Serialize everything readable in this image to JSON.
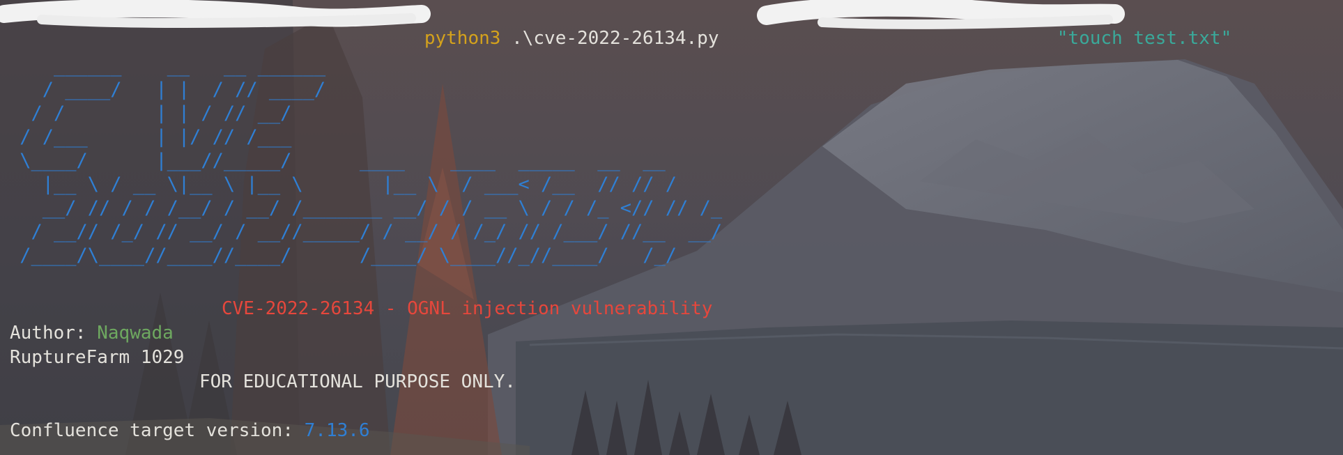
{
  "command": {
    "program": "python3",
    "script": ".\\cve-2022-26134.py",
    "argument": "\"touch test.txt\""
  },
  "banner": {
    "ascii_art": "    ______    __   __ ______\n   / ____/   | |  / // ____/\n  / /        | | / // __/\n / /___      | |/ // /___\n \\____/      |___//_____/      ____    ____  _____  __  __\n   |__ \\ / __ \\|__ \\ |__ \\       |__ \\  / ___< /__  // // /\n   __/ // / / /__/ / __/ /_______ __/ / / __ \\ / / /_ <// // /_\n  / __// /_/ // __/ / __//_____/ / __/ / /_/ // /___/ //__  __/\n /____/\\____//____//____/      /____/ \\____//_//____/   /_/",
    "subtitle": "CVE-2022-26134 - OGNL injection vulnerability"
  },
  "author": {
    "label": "Author: ",
    "name": "Naqwada"
  },
  "org_line": "RuptureFarm 1029",
  "disclaimer": "FOR EDUCATIONAL PURPOSE ONLY.",
  "target": {
    "label": "Confluence target version: ",
    "version": "7.13.6"
  },
  "colors": {
    "program": "#d4a21c",
    "argument": "#3aa99a",
    "ascii_art": "#2f7fd4",
    "subtitle": "#e6473c",
    "author_name": "#6ea860",
    "version": "#2f7fd4",
    "text": "#e4e2dc"
  }
}
